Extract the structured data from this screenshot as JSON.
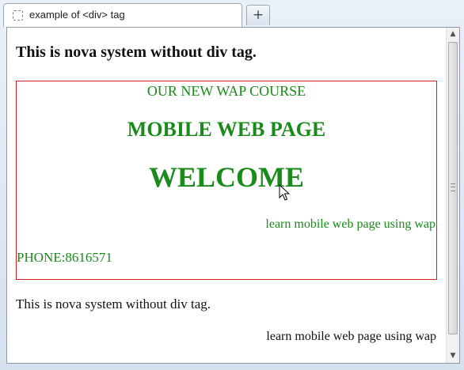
{
  "tab": {
    "title": "example of <div> tag",
    "new_tab_label": "+"
  },
  "page": {
    "heading": "This is nova system without div tag.",
    "div_box": {
      "course": "OUR NEW WAP COURSE",
      "mobile_page": "MOBILE WEB PAGE",
      "welcome": "WELCOME",
      "learn": "learn mobile web page using wap",
      "phone": "PHONE:8616571"
    },
    "plain_line": "This is nova system without div tag.",
    "learn_plain": "learn mobile web page using wap"
  },
  "scrollbar": {
    "up_glyph": "▲",
    "down_glyph": "▼"
  },
  "colors": {
    "div_border": "#e01b1b",
    "div_text": "#1a8a1a"
  }
}
